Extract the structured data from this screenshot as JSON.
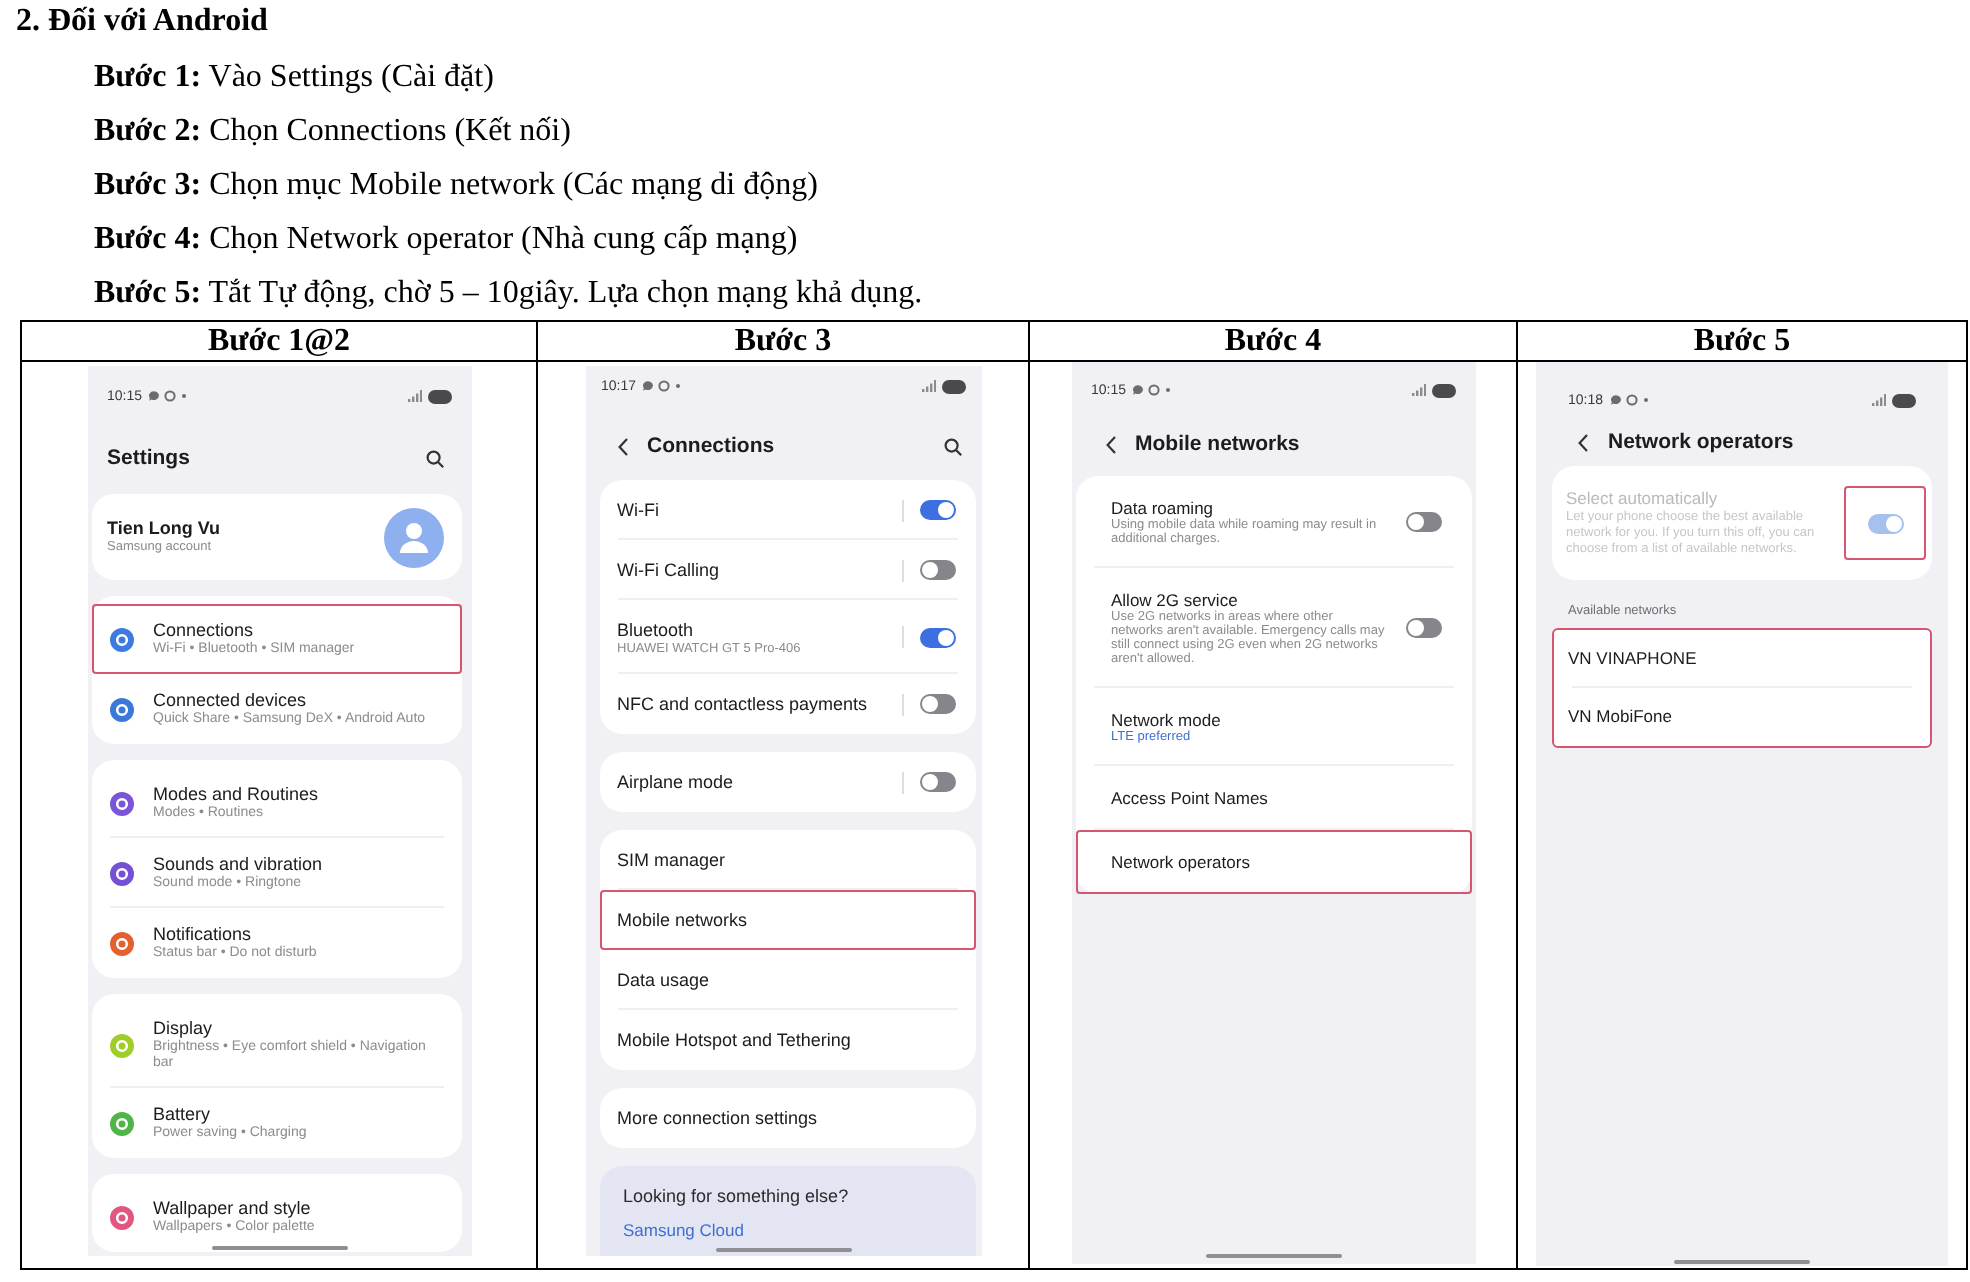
{
  "heading": "2. Đối với Android",
  "steps": [
    "**Bước 1:** Vào Settings (Cài đặt)",
    "**Bước 2:** Chọn Connections (Kết nối)",
    "**Bước 3:** Chọn mục Mobile network (Các mạng di động)",
    "**Bước 4:** Chọn Network operator (Nhà cung cấp mạng)",
    "**Bước 5:** Tắt Tự động, chờ 5 – 10giây. Lựa chọn mạng khả dụng."
  ],
  "table": {
    "columns": [
      "Bước 1@2",
      "Bước 3",
      "Bước 4",
      "Bước 5"
    ],
    "screenshots": [
      {
        "kind": "settings",
        "time": "10:15",
        "title": "Settings",
        "blocks": [
          {
            "kind": "account",
            "name": "Tien Long Vu",
            "subtitle": "Samsung account"
          },
          {
            "kind": "group",
            "highlighted": false,
            "items": [
              {
                "kind": "icon",
                "title": "Connections",
                "subtitle": "Wi-Fi • Bluetooth • SIM manager",
                "color": "#3d7be0",
                "highlighted": true
              },
              {
                "kind": "icon",
                "title": "Connected devices",
                "subtitle": "Quick Share • Samsung DeX • Android Auto",
                "color": "#3b79d9",
                "highlighted": false
              }
            ]
          },
          {
            "kind": "group",
            "highlighted": false,
            "items": [
              {
                "kind": "icon",
                "title": "Modes and Routines",
                "subtitle": "Modes • Routines",
                "color": "#7a55d8",
                "highlighted": false
              },
              {
                "kind": "icon",
                "title": "Sounds and vibration",
                "subtitle": "Sound mode • Ringtone",
                "color": "#7550d4",
                "highlighted": false
              },
              {
                "kind": "icon",
                "title": "Notifications",
                "subtitle": "Status bar • Do not disturb",
                "color": "#e2612d",
                "highlighted": false
              }
            ]
          },
          {
            "kind": "group",
            "highlighted": false,
            "items": [
              {
                "kind": "icon",
                "title": "Display",
                "subtitle": "Brightness • Eye comfort shield • Navigation bar",
                "color": "#9fce2b",
                "highlighted": false
              },
              {
                "kind": "icon",
                "title": "Battery",
                "subtitle": "Power saving • Charging",
                "color": "#4fb548",
                "highlighted": false
              }
            ]
          },
          {
            "kind": "group",
            "highlighted": false,
            "items": [
              {
                "kind": "icon",
                "title": "Wallpaper and style",
                "subtitle": "Wallpapers • Color palette",
                "color": "#e2577f",
                "highlighted": false
              }
            ]
          }
        ]
      },
      {
        "kind": "connections",
        "time": "10:17",
        "title": "Connections",
        "blocks": [
          {
            "kind": "group",
            "highlighted": false,
            "items": [
              {
                "kind": "split_toggle",
                "title": "Wi-Fi",
                "on": true,
                "toggle_highlighted": false,
                "highlighted": false
              },
              {
                "kind": "split_toggle",
                "title": "Wi-Fi Calling",
                "on": false,
                "toggle_highlighted": false,
                "highlighted": false
              },
              {
                "kind": "split_toggle",
                "title": "Bluetooth",
                "subtitle": "HUAWEI WATCH GT 5 Pro-406",
                "on": true,
                "toggle_highlighted": false,
                "highlighted": false
              },
              {
                "kind": "split_toggle",
                "title": "NFC and contactless payments",
                "on": false,
                "toggle_highlighted": false,
                "highlighted": false
              }
            ]
          },
          {
            "kind": "group",
            "highlighted": false,
            "items": [
              {
                "kind": "split_toggle",
                "title": "Airplane mode",
                "on": false,
                "toggle_highlighted": false,
                "highlighted": false
              }
            ]
          },
          {
            "kind": "group",
            "highlighted": false,
            "items": [
              {
                "kind": "link",
                "title": "SIM manager",
                "highlighted": false
              },
              {
                "kind": "link",
                "title": "Mobile networks",
                "highlighted": true
              },
              {
                "kind": "link",
                "title": "Data usage",
                "highlighted": false
              },
              {
                "kind": "link",
                "title": "Mobile Hotspot and Tethering",
                "highlighted": false
              }
            ]
          },
          {
            "kind": "group",
            "highlighted": false,
            "items": [
              {
                "kind": "link",
                "title": "More connection settings",
                "highlighted": false
              }
            ]
          },
          {
            "kind": "suggestion",
            "title": "Looking for something else?",
            "link": "Samsung Cloud"
          }
        ]
      },
      {
        "kind": "mobile_networks",
        "time": "10:15",
        "title": "Mobile networks",
        "blocks": [
          {
            "kind": "group",
            "highlighted": false,
            "items": [
              {
                "kind": "toggle",
                "title": "Data roaming",
                "subtitle": "Using mobile data while roaming may result in additional charges.",
                "on": false,
                "toggle_highlighted": false,
                "highlighted": false
              },
              {
                "kind": "toggle",
                "title": "Allow 2G service",
                "subtitle": "Use 2G networks in areas where other networks aren't available. Emergency calls may still connect using 2G even when 2G networks aren't allowed.",
                "on": false,
                "toggle_highlighted": false,
                "highlighted": false
              },
              {
                "kind": "link",
                "title": "Network mode",
                "value": "LTE preferred",
                "highlighted": false
              },
              {
                "kind": "link",
                "title": "Access Point Names",
                "highlighted": false
              },
              {
                "kind": "link",
                "title": "Network operators",
                "highlighted": true
              }
            ]
          }
        ]
      },
      {
        "kind": "network_operators",
        "time": "10:18",
        "title": "Network operators",
        "blocks": [
          {
            "kind": "group",
            "highlighted": false,
            "items": [
              {
                "kind": "toggle",
                "title": "Select automatically",
                "subtitle": "Let your phone choose the best available network for you. If you turn this off, you can choose from a list of available networks.",
                "on": true,
                "disabled": true,
                "toggle_highlighted": true,
                "highlighted": false
              }
            ]
          },
          {
            "kind": "label",
            "text": "Available networks"
          },
          {
            "kind": "group",
            "highlighted": true,
            "items": [
              {
                "kind": "link",
                "title": "VN VINAPHONE",
                "highlighted": false
              },
              {
                "kind": "link",
                "title": "VN MobiFone",
                "highlighted": false
              }
            ]
          }
        ]
      }
    ]
  }
}
